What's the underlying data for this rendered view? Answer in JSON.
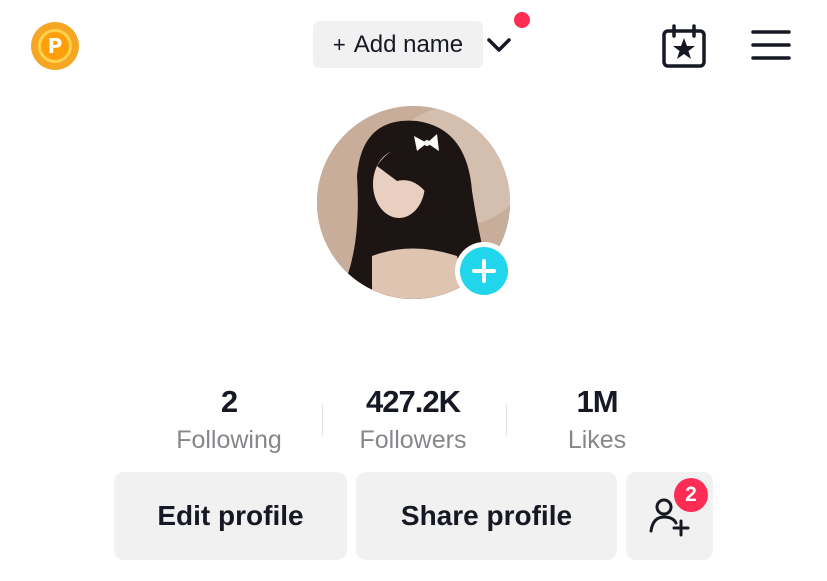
{
  "header": {
    "points_badge_letter": "P",
    "add_name_plus": "+",
    "add_name_label": "Add name"
  },
  "stats": [
    {
      "value": "2",
      "label": "Following"
    },
    {
      "value": "427.2K",
      "label": "Followers"
    },
    {
      "value": "1M",
      "label": "Likes"
    }
  ],
  "actions": {
    "edit_profile": "Edit profile",
    "share_profile": "Share profile",
    "friends_badge_count": "2"
  },
  "colors": {
    "accent_red": "#fe2c55",
    "accent_cyan": "#20d5ec",
    "button_bg": "#f1f1f2",
    "points_orange": "#ff9f0a"
  },
  "icons": {
    "points": "points-coin-icon",
    "chevron": "chevron-down-icon",
    "calendar": "calendar-star-icon",
    "menu": "hamburger-menu-icon",
    "avatar_add": "plus-icon",
    "add_friends": "add-friend-icon"
  }
}
